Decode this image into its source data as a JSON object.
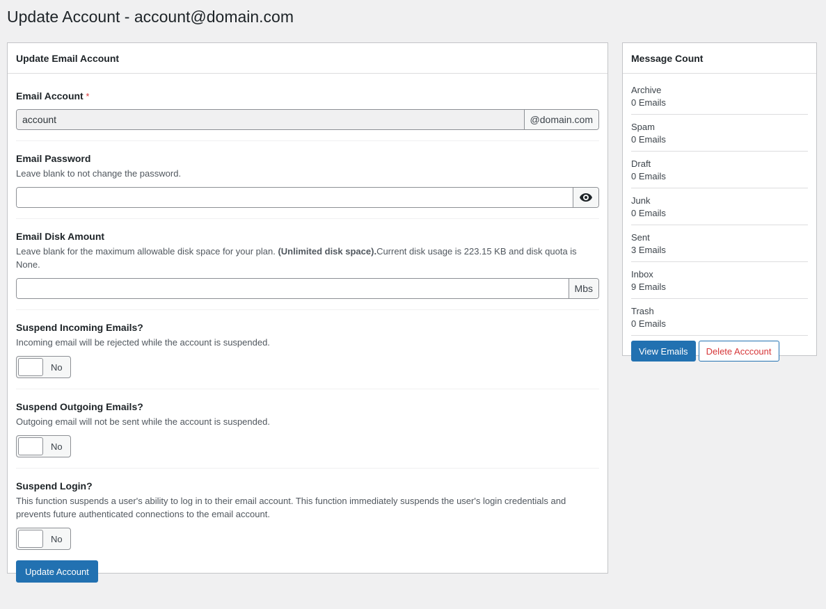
{
  "page": {
    "title": "Update Account - account@domain.com"
  },
  "form": {
    "header": "Update Email Account",
    "email": {
      "label": "Email Account",
      "required_mark": "*",
      "value": "account",
      "suffix": "@domain.com"
    },
    "password": {
      "label": "Email Password",
      "desc": "Leave blank to not change the password.",
      "value": ""
    },
    "disk": {
      "label": "Email Disk Amount",
      "desc_prefix": "Leave blank for the maximum allowable disk space for your plan. ",
      "desc_bold": "(Unlimited disk space).",
      "desc_suffix": "Current disk usage is 223.15 KB and disk quota is None.",
      "value": "",
      "unit": "Mbs"
    },
    "suspend_incoming": {
      "label": "Suspend Incoming Emails?",
      "desc": "Incoming email will be rejected while the account is suspended.",
      "state": "No"
    },
    "suspend_outgoing": {
      "label": "Suspend Outgoing Emails?",
      "desc": "Outgoing email will not be sent while the account is suspended.",
      "state": "No"
    },
    "suspend_login": {
      "label": "Suspend Login?",
      "desc": "This function suspends a user's ability to log in to their email account. This function immediately suspends the user's login credentials and prevents future authenticated connections to the email account.",
      "state": "No"
    },
    "submit_label": "Update Account"
  },
  "message_count": {
    "header": "Message Count",
    "folders": [
      {
        "name": "Archive",
        "count": "0 Emails"
      },
      {
        "name": "Spam",
        "count": "0 Emails"
      },
      {
        "name": "Draft",
        "count": "0 Emails"
      },
      {
        "name": "Junk",
        "count": "0 Emails"
      },
      {
        "name": "Sent",
        "count": "3 Emails"
      },
      {
        "name": "Inbox",
        "count": "9 Emails"
      },
      {
        "name": "Trash",
        "count": "0 Emails"
      }
    ],
    "view_label": "View Emails",
    "delete_label": "Delete Acccount"
  },
  "colors": {
    "primary": "#2271b1",
    "danger": "#d63638",
    "background": "#f0f0f1"
  },
  "icons": {
    "password_toggle": "eye-icon"
  }
}
